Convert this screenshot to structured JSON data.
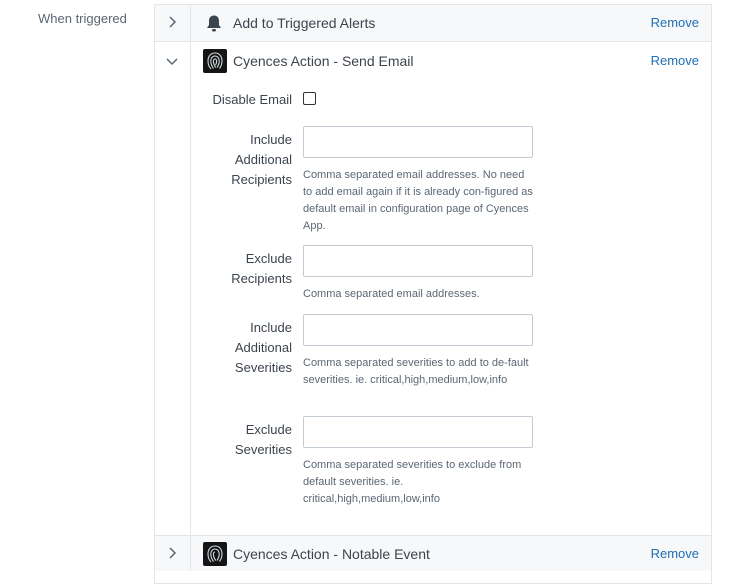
{
  "section_label": "When triggered",
  "actions": [
    {
      "title": "Add to Triggered Alerts",
      "remove_label": "Remove",
      "icon": "bell-icon",
      "expanded": false
    },
    {
      "title": "Cyences Action - Send Email",
      "remove_label": "Remove",
      "icon": "fingerprint-logo-icon",
      "expanded": true
    },
    {
      "title": "Cyences Action - Notable Event",
      "remove_label": "Remove",
      "icon": "fingerprint-logo-icon",
      "expanded": false
    }
  ],
  "send_email_form": {
    "disable_email": {
      "label": "Disable Email",
      "checked": false
    },
    "include_recipients": {
      "label": "Include Additional Recipients",
      "value": "",
      "help": "Comma separated email addresses. No need to add email again if it is already con-figured as default email in configuration page of Cyences App."
    },
    "exclude_recipients": {
      "label": "Exclude Recipients",
      "value": "",
      "help": "Comma separated email addresses."
    },
    "include_severities": {
      "label": "Include Additional Severities",
      "value": "",
      "help": "Comma separated severities to add to de-fault severities. ie. critical,high,medium,low,info"
    },
    "exclude_severities": {
      "label": "Exclude Severities",
      "value": "",
      "help": "Comma separated severities to exclude from default severities. ie. critical,high,medium,low,info"
    }
  }
}
